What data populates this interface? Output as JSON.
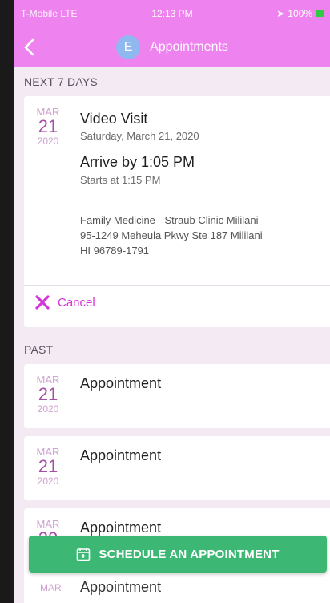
{
  "status": {
    "carrier": "T-Mobile  LTE",
    "time": "12:13 PM",
    "battery": "100%"
  },
  "nav": {
    "avatar_letter": "E",
    "title": "Appointments"
  },
  "sections": {
    "next": "NEXT 7 DAYS",
    "past": "PAST"
  },
  "upcoming": {
    "month": "MAR",
    "day": "21",
    "year": "2020",
    "title": "Video Visit",
    "date_text": "Saturday, March 21, 2020",
    "arrive": "Arrive by 1:05 PM",
    "starts": "Starts at 1:15 PM",
    "address_line1": "Family Medicine - Straub Clinic Mililani",
    "address_line2": "95-1249 Meheula Pkwy Ste 187 Mililani",
    "address_line3": "HI 96789-1791",
    "cancel_label": "Cancel"
  },
  "past": [
    {
      "month": "MAR",
      "day": "21",
      "year": "2020",
      "title": "Appointment"
    },
    {
      "month": "MAR",
      "day": "21",
      "year": "2020",
      "title": "Appointment"
    },
    {
      "month": "MAR",
      "day": "20",
      "year": "",
      "title": "Appointment"
    },
    {
      "month": "MAR",
      "title": "Appointment"
    }
  ],
  "schedule_button": "SCHEDULE AN APPOINTMENT",
  "colors": {
    "header": "#ee82ee",
    "accent": "#d633d6",
    "button": "#3cb874"
  }
}
